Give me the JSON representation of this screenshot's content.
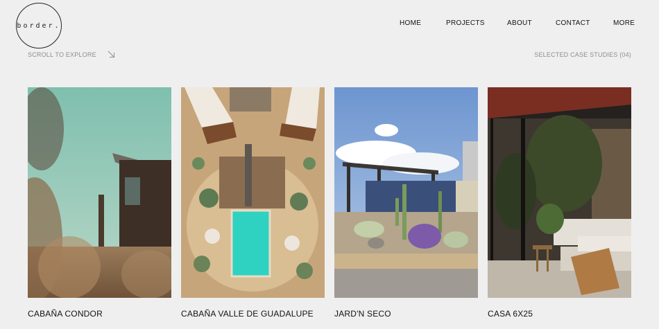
{
  "logo": {
    "text": "border."
  },
  "nav": {
    "items": [
      {
        "label": "HOME"
      },
      {
        "label": "PROJECTS"
      },
      {
        "label": "ABOUT"
      },
      {
        "label": "CONTACT"
      },
      {
        "label": "MORE"
      }
    ]
  },
  "hero": {
    "scroll_hint": "SCROLL TO EXPLORE",
    "arrow_icon": "arrow-down-right-icon",
    "case_count": "SELECTED CASE STUDIES (04)"
  },
  "projects": [
    {
      "title": "CABAÑA CONDOR"
    },
    {
      "title": "CABAÑA VALLE DE GUADALUPE"
    },
    {
      "title": "JARD'N SECO"
    },
    {
      "title": "CASA 6X25"
    }
  ],
  "colors": {
    "background": "#efefef",
    "text": "#111111",
    "muted": "#8d8d8d",
    "pool": "#2fd2c0",
    "sky": "#8aa9d6"
  }
}
